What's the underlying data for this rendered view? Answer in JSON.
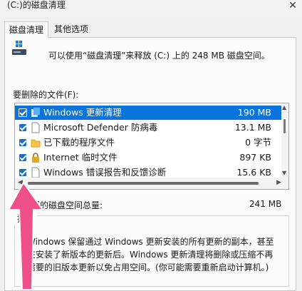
{
  "window": {
    "title": "(C:)的磁盘清理",
    "close_glyph": "✕"
  },
  "tabs": [
    {
      "label": "磁盘清理"
    },
    {
      "label": "其他选项"
    }
  ],
  "summary_text": "可以使用“磁盘清理”来释放 (C:) 上的 248 MB 磁盘空间。",
  "list": {
    "label": "要删除的文件(F):",
    "items": [
      {
        "name": "Windows 更新清理",
        "size": "190 MB",
        "checked": true,
        "selected": true,
        "icon": "windows-update-icon"
      },
      {
        "name": "Microsoft Defender 防病毒",
        "size": "13.1 MB",
        "checked": true,
        "selected": false,
        "icon": "document-icon"
      },
      {
        "name": "已下载的程序文件",
        "size": "0 字节",
        "checked": true,
        "selected": false,
        "icon": "folder-icon"
      },
      {
        "name": "Internet 临时文件",
        "size": "897 KB",
        "checked": true,
        "selected": false,
        "icon": "lock-icon"
      },
      {
        "name": "Windows 错误报告和反馈诊断",
        "size": "15.6 KB",
        "checked": true,
        "selected": false,
        "icon": "document-icon"
      }
    ]
  },
  "total": {
    "label": "可获得的磁盘空间总量:",
    "value": "241 MB"
  },
  "description": {
    "caption": "描述",
    "text": "Windows 保留通过 Windows 更新安装的所有更新的副本，甚至在安装了新版本的更新后。Windows 更新清理将删除或压缩不再需要的旧版本更新以免占用空间。(你可能需要重新启动计算机。)"
  },
  "colors": {
    "selection": "#0a74da",
    "checkbox": "#1a6fce",
    "arrow": "#f0508a"
  }
}
